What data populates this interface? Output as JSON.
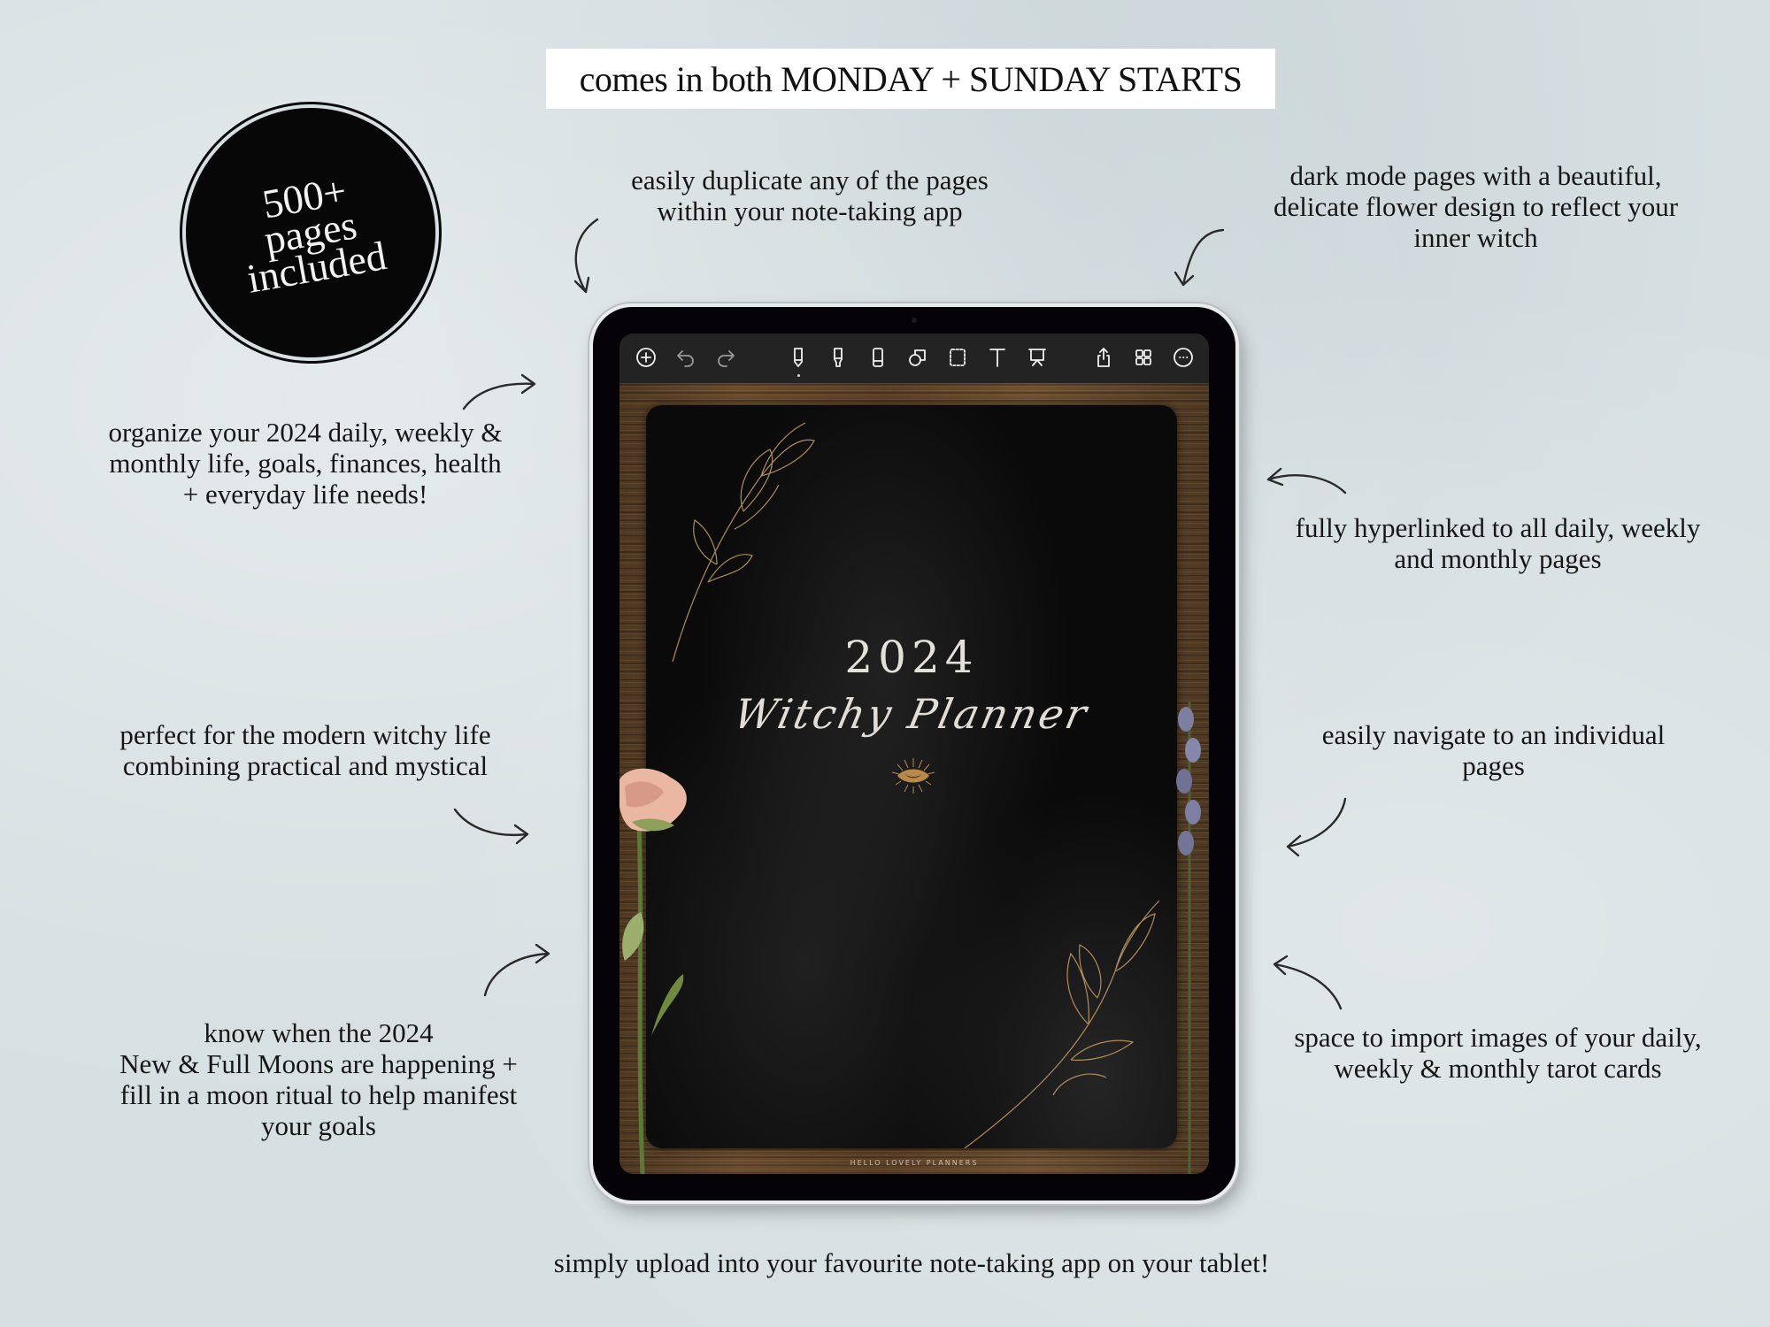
{
  "banner": {
    "text": "comes in both MONDAY + SUNDAY STARTS"
  },
  "badge": {
    "lines": [
      "500+",
      "pages",
      "included"
    ]
  },
  "features": {
    "duplicate": [
      "easily duplicate any of the pages",
      "within your note-taking app"
    ],
    "dark_mode": [
      "dark mode pages with a beautiful,",
      "delicate flower design to reflect your",
      "inner witch"
    ],
    "organize": [
      "organize your 2024 daily, weekly &",
      "monthly life, goals, finances, health",
      "+ everyday life needs!"
    ],
    "hyperlinked": [
      "fully hyperlinked to all daily, weekly",
      "and monthly pages"
    ],
    "modern": [
      "perfect for the modern witchy life",
      "combining practical and mystical"
    ],
    "navigate": [
      "easily navigate to an individual",
      "pages"
    ],
    "moons": [
      "know when the 2024",
      "New & Full Moons are happening  +",
      "fill in a moon ritual to help manifest",
      "your goals"
    ],
    "tarot": [
      "space to import images of your daily,",
      "weekly & monthly tarot cards"
    ],
    "upload": "simply upload into your favourite note-taking app on your tablet!"
  },
  "tablet": {
    "toolbar": [
      {
        "id": "add",
        "icon": "plus-circle-icon"
      },
      {
        "id": "undo",
        "icon": "undo-icon"
      },
      {
        "id": "redo",
        "icon": "redo-icon"
      },
      {
        "id": "pen",
        "icon": "pen-icon",
        "active": true
      },
      {
        "id": "highlighter",
        "icon": "highlighter-icon"
      },
      {
        "id": "eraser",
        "icon": "eraser-icon"
      },
      {
        "id": "shapes",
        "icon": "shapes-icon"
      },
      {
        "id": "lasso",
        "icon": "lasso-select-icon"
      },
      {
        "id": "text",
        "icon": "text-icon"
      },
      {
        "id": "presentation",
        "icon": "presentation-icon"
      },
      {
        "id": "share",
        "icon": "share-icon"
      },
      {
        "id": "pages",
        "icon": "grid-icon"
      },
      {
        "id": "more",
        "icon": "more-icon"
      }
    ],
    "cover": {
      "year": "2024",
      "title": "Witchy Planner",
      "brand": "HELLO LOVELY PLANNERS"
    }
  },
  "colors": {
    "background": "#d6dfe2",
    "page": "#0a0a0a",
    "gold": "#b08d5a",
    "toolbar": "#232323",
    "wood": "#5a4128"
  }
}
